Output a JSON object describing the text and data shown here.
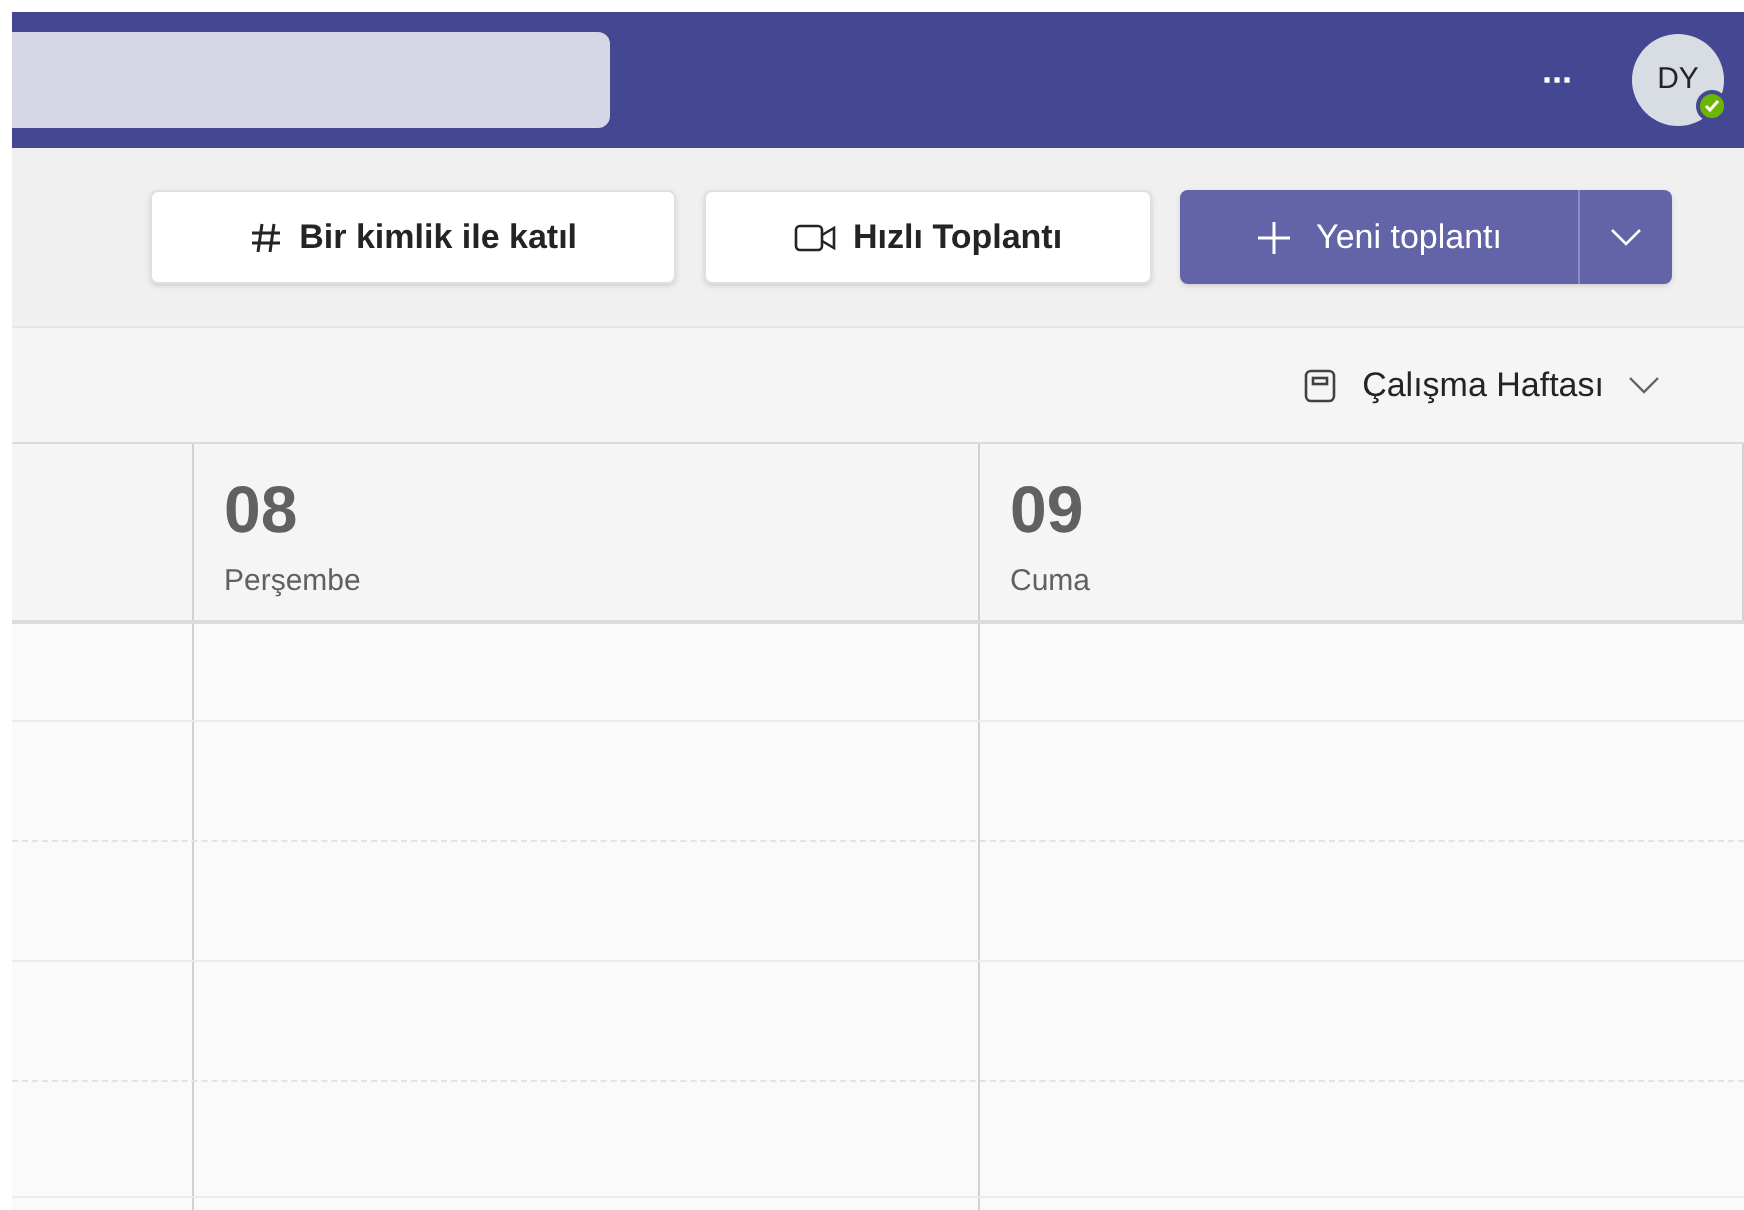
{
  "top_bar": {
    "more": "···",
    "avatar": {
      "initials": "DY",
      "online": true
    }
  },
  "toolbar": {
    "buttons": [
      {
        "kind": "hash",
        "label": "Bir kimlik ile katıl"
      },
      {
        "kind": "video",
        "label": "Hızlı Toplantı"
      },
      {
        "kind": "primary",
        "label": "Yeni toplantı"
      }
    ]
  },
  "view_selector": {
    "label": "Çalışma Haftası"
  },
  "days": [
    {
      "number": "08",
      "name": "Perşembe"
    },
    {
      "number": "09",
      "name": "Cuma"
    }
  ]
}
